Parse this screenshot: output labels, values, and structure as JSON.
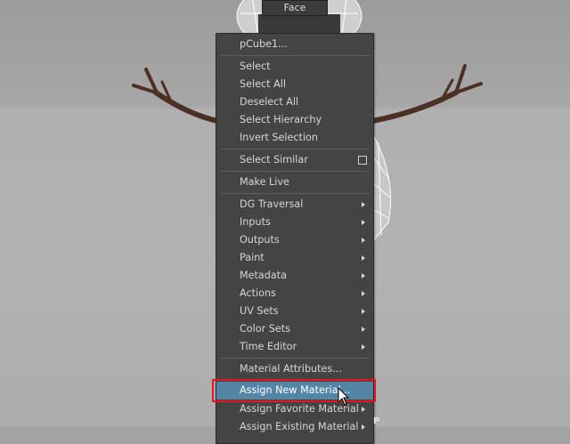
{
  "viewport": {
    "face_tag": "Face"
  },
  "menu": {
    "header": "pCube1...",
    "group_select": [
      "Select",
      "Select All",
      "Deselect All",
      "Select Hierarchy",
      "Invert Selection"
    ],
    "select_similar": "Select Similar",
    "make_live": "Make Live",
    "submenus": [
      "DG Traversal",
      "Inputs",
      "Outputs",
      "Paint",
      "Metadata",
      "Actions",
      "UV Sets",
      "Color Sets",
      "Time Editor"
    ],
    "material_attributes": "Material Attributes...",
    "assign_new_material": "Assign New Material...",
    "assign_favorite_material": "Assign Favorite Material",
    "assign_existing_material": "Assign Existing Material"
  },
  "colors": {
    "menu_bg": "#444444",
    "highlight": "#5285a6",
    "callout_border": "#e8141a"
  },
  "icons": {
    "submenu": "chevron-right-icon",
    "option_box": "option-box-icon",
    "cursor": "mouse-pointer-icon"
  }
}
